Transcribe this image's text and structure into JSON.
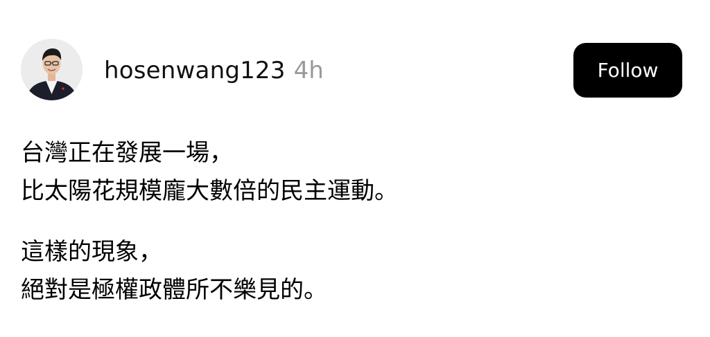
{
  "post": {
    "author": {
      "username": "hosenwang123",
      "timestamp": "4h",
      "avatar_icon": "profile-photo"
    },
    "follow_label": "Follow",
    "paragraphs": [
      [
        "台灣正在發展一場，",
        "比太陽花規模龐大數倍的民主運動。"
      ],
      [
        "這樣的現象，",
        "絕對是極權政體所不樂見的。"
      ]
    ]
  },
  "colors": {
    "background": "#ffffff",
    "text": "#000000",
    "timestamp": "#999999",
    "follow_button_bg": "#000000",
    "follow_button_text": "#ffffff"
  }
}
